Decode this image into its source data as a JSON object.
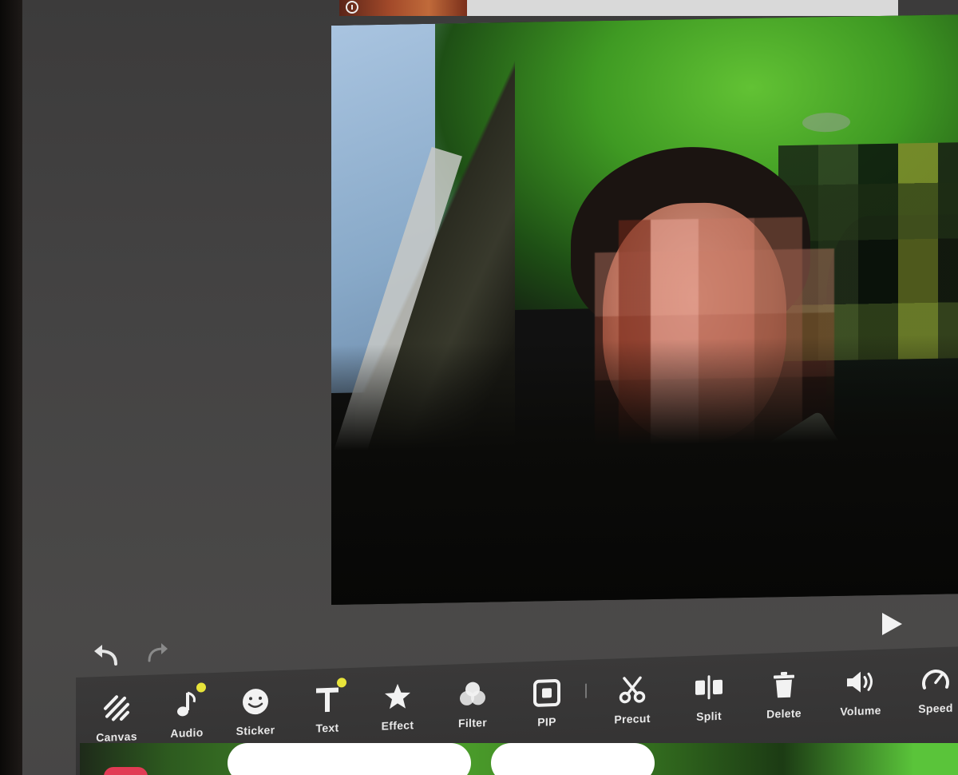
{
  "app": {
    "accent_color": "#e8e43a",
    "toolbar_text_color": "#e8e8e8",
    "background_color": "#444343"
  },
  "controls": {
    "undo_icon": "undo-arrow-icon",
    "redo_icon": "redo-arrow-icon",
    "play_icon": "play-icon"
  },
  "toolbar": {
    "items": [
      {
        "label": "Canvas",
        "icon": "canvas-stripes-icon",
        "badge": false
      },
      {
        "label": "Audio",
        "icon": "music-note-icon",
        "badge": true
      },
      {
        "label": "Sticker",
        "icon": "smiley-icon",
        "badge": false
      },
      {
        "label": "Text",
        "icon": "text-t-icon",
        "badge": true
      },
      {
        "label": "Effect",
        "icon": "star-icon",
        "badge": false
      },
      {
        "label": "Filter",
        "icon": "filter-circles-icon",
        "badge": false
      },
      {
        "label": "PIP",
        "icon": "pip-icon",
        "badge": false
      },
      {
        "label": "Precut",
        "icon": "scissors-icon",
        "badge": false
      },
      {
        "label": "Split",
        "icon": "split-icon",
        "badge": false
      },
      {
        "label": "Delete",
        "icon": "trash-icon",
        "badge": false
      },
      {
        "label": "Volume",
        "icon": "speaker-icon",
        "badge": false
      },
      {
        "label": "Speed",
        "icon": "speedometer-icon",
        "badge": false
      }
    ]
  }
}
